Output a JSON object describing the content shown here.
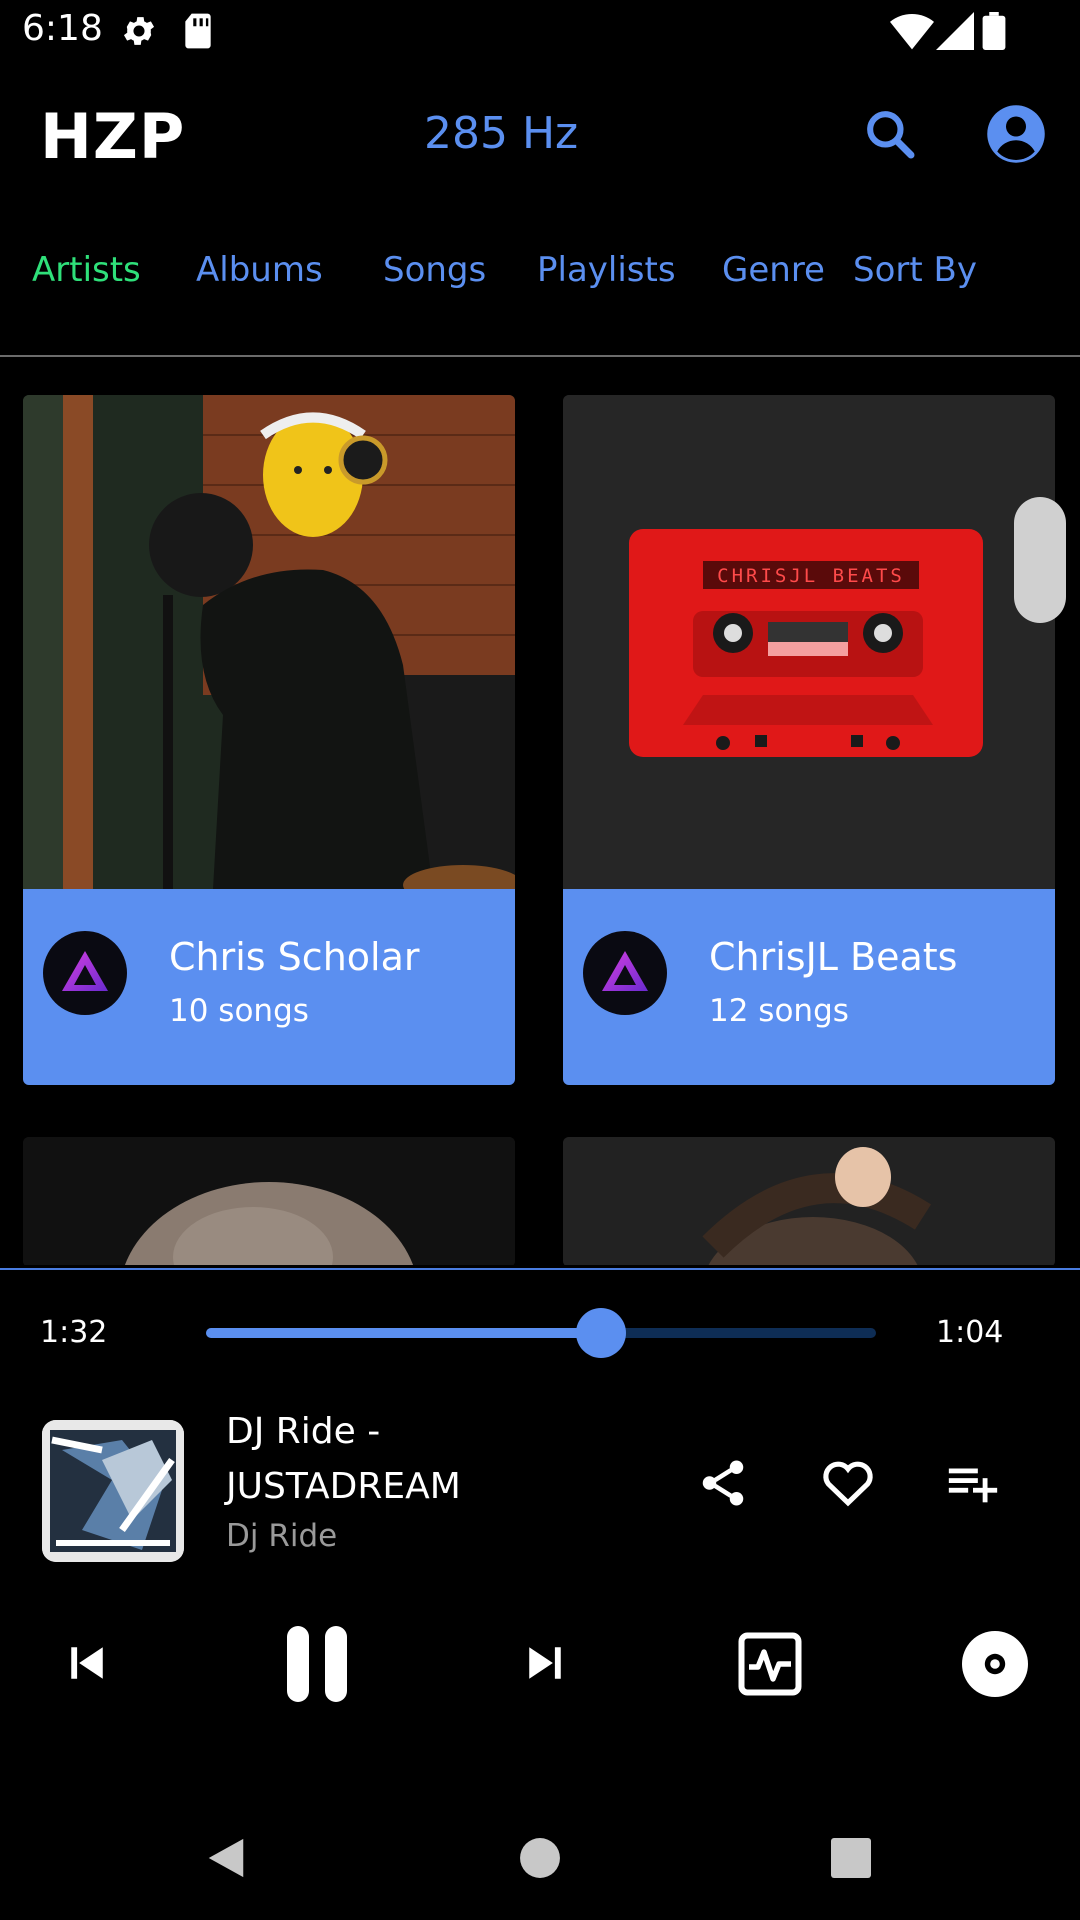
{
  "status_bar": {
    "time": "6:18",
    "icons": [
      "gear-icon",
      "sd-card-icon",
      "wifi-icon",
      "signal-icon",
      "battery-icon"
    ]
  },
  "header": {
    "logo": "HZP",
    "frequency": "285 Hz",
    "accent_color": "#5b8ff0"
  },
  "tabs": [
    {
      "label": "Artists",
      "active": true
    },
    {
      "label": "Albums",
      "active": false
    },
    {
      "label": "Songs",
      "active": false
    },
    {
      "label": "Playlists",
      "active": false
    },
    {
      "label": "Genre",
      "active": false
    },
    {
      "label": "Sort By",
      "active": false
    }
  ],
  "artists": [
    {
      "name": "Chris Scholar",
      "songs": "10 songs"
    },
    {
      "name": "ChrisJL Beats",
      "songs": "12 songs"
    }
  ],
  "cassette_label": "CHRISJL BEATS",
  "player": {
    "elapsed": "1:32",
    "remaining": "1:04",
    "progress": 0.59,
    "title": "DJ Ride - JUSTADREAM",
    "artist": "Dj Ride"
  },
  "colors": {
    "accent": "#5b8ff0",
    "active_tab": "#2fe07a",
    "background": "#000000"
  }
}
